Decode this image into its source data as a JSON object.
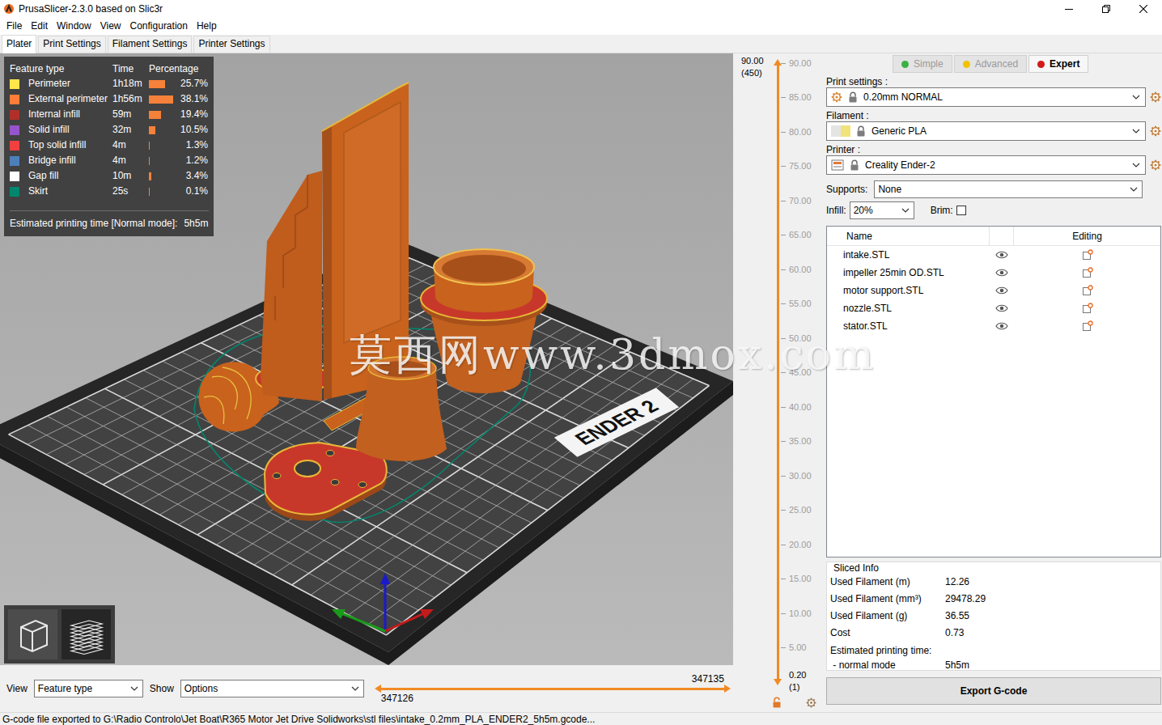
{
  "window": {
    "title": "PrusaSlicer-2.3.0 based on Slic3r"
  },
  "menu": [
    "File",
    "Edit",
    "Window",
    "View",
    "Configuration",
    "Help"
  ],
  "tabs": [
    {
      "label": "Plater",
      "selected": true
    },
    {
      "label": "Print Settings",
      "selected": false
    },
    {
      "label": "Filament Settings",
      "selected": false
    },
    {
      "label": "Printer Settings",
      "selected": false
    }
  ],
  "legend": {
    "columns": [
      "Feature type",
      "Time",
      "Percentage"
    ],
    "rows": [
      {
        "name": "Perimeter",
        "time": "1h18m",
        "level": 0.257,
        "percentage": "25.7%",
        "color": "#ffe64d"
      },
      {
        "name": "External perimeter",
        "time": "1h56m",
        "level": 0.381,
        "percentage": "38.1%",
        "color": "#ff7d38"
      },
      {
        "name": "Internal infill",
        "time": "59m",
        "level": 0.194,
        "percentage": "19.4%",
        "color": "#b03029"
      },
      {
        "name": "Solid infill",
        "time": "32m",
        "level": 0.105,
        "percentage": "10.5%",
        "color": "#9654cc"
      },
      {
        "name": "Top solid infill",
        "time": "4m",
        "level": 0.013,
        "percentage": "1.3%",
        "color": "#f04040"
      },
      {
        "name": "Bridge infill",
        "time": "4m",
        "level": 0.012,
        "percentage": "1.2%",
        "color": "#4d80ba"
      },
      {
        "name": "Gap fill",
        "time": "10m",
        "level": 0.034,
        "percentage": "3.4%",
        "color": "#ffffff"
      },
      {
        "name": "Skirt",
        "time": "25s",
        "level": 0.001,
        "percentage": "0.1%",
        "color": "#00876e"
      }
    ],
    "estimate_label": "Estimated printing time [Normal mode]:",
    "estimate": "5h5m"
  },
  "bed_label": "ENDER 2",
  "watermark": "莫西网www.3dmox.com",
  "view_controls": {
    "view_label": "View",
    "view_value": "Feature type",
    "show_label": "Show",
    "show_value": "Options"
  },
  "horizontal_slider": {
    "upper": "347135",
    "lower": "347126"
  },
  "layer_slider": {
    "top": {
      "value": "90.00",
      "layer": "(450)"
    },
    "bottom": {
      "value": "0.20",
      "layer": "(1)"
    },
    "ticks": [
      "90.00",
      "85.00",
      "80.00",
      "75.00",
      "70.00",
      "65.00",
      "60.00",
      "55.00",
      "50.00",
      "45.00",
      "40.00",
      "35.00",
      "30.00",
      "25.00",
      "20.00",
      "15.00",
      "10.00",
      "5.00"
    ]
  },
  "modes": [
    {
      "label": "Simple",
      "selected": false,
      "color": "#3cb043"
    },
    {
      "label": "Advanced",
      "selected": false,
      "color": "#f2c200"
    },
    {
      "label": "Expert",
      "selected": true,
      "color": "#d11a1a"
    }
  ],
  "presets": [
    {
      "label": "Print settings :",
      "value": "0.20mm NORMAL",
      "kind": "print"
    },
    {
      "label": "Filament :",
      "value": "Generic PLA",
      "kind": "filament"
    },
    {
      "label": "Printer :",
      "value": "Creality Ender-2",
      "kind": "printer"
    }
  ],
  "supports": {
    "label": "Supports:",
    "value": "None"
  },
  "infill": {
    "label": "Infill:",
    "value": "20%"
  },
  "brim": {
    "label": "Brim:",
    "checked": false
  },
  "objects": {
    "columns": [
      "Name",
      "Editing"
    ],
    "rows": [
      {
        "name": "intake.STL",
        "visible": true
      },
      {
        "name": "impeller 25min OD.STL",
        "visible": true
      },
      {
        "name": "motor support.STL",
        "visible": true
      },
      {
        "name": "nozzle.STL",
        "visible": true
      },
      {
        "name": "stator.STL",
        "visible": true
      }
    ]
  },
  "sliced_info": {
    "title": "Sliced Info",
    "rows": [
      {
        "label": "Used Filament (m)",
        "value": "12.26"
      },
      {
        "label": "Used Filament (mm³)",
        "value": "29478.29"
      },
      {
        "label": "Used Filament (g)",
        "value": "36.55"
      },
      {
        "label": "Cost",
        "value": "0.73"
      }
    ],
    "time_label": "Estimated printing time:",
    "time_mode": " - normal mode",
    "time_value": "5h5m"
  },
  "export_button": "Export G-code",
  "status_bar": "G-code file exported to G:\\Radio Controlo\\Jet Boat\\R365 Motor Jet Drive Solidworks\\stl files\\intake_0.2mm_PLA_ENDER2_5h5m.gcode..."
}
